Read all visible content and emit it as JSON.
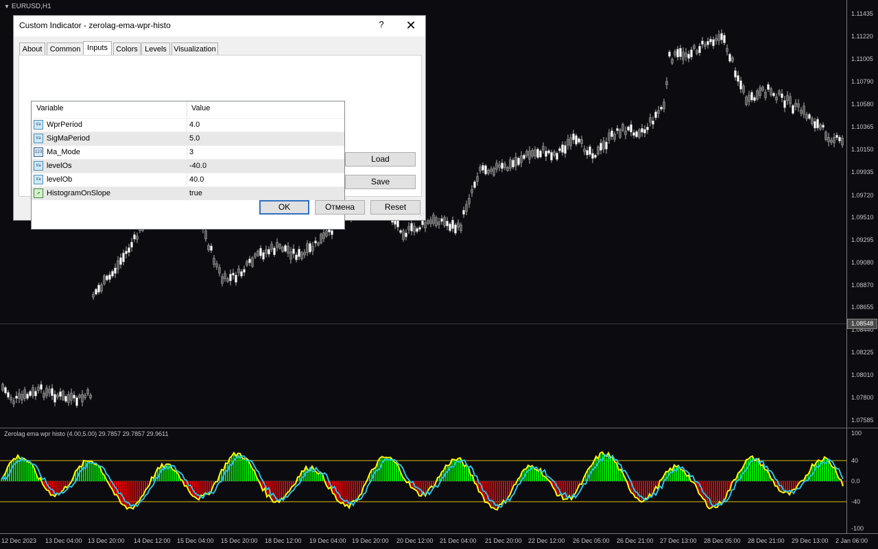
{
  "chart": {
    "symbol": "EURUSD,H1",
    "current_price": "1.08548",
    "price_ticks": [
      "1.11435",
      "1.11220",
      "1.11005",
      "1.10790",
      "1.10580",
      "1.10365",
      "1.10150",
      "1.09935",
      "1.09720",
      "1.09510",
      "1.09295",
      "1.09080",
      "1.08870",
      "1.08655",
      "1.08440",
      "1.08225",
      "1.08010",
      "1.07800",
      "1.07585"
    ],
    "time_ticks": [
      "12 Dec 2023",
      "13 Dec 04:00",
      "13 Dec 20:00",
      "14 Dec 12:00",
      "15 Dec 04:00",
      "15 Dec 20:00",
      "18 Dec 12:00",
      "19 Dec 04:00",
      "19 Dec 20:00",
      "20 Dec 12:00",
      "21 Dec 04:00",
      "21 Dec 20:00",
      "22 Dec 12:00",
      "26 Dec 05:00",
      "26 Dec 21:00",
      "27 Dec 13:00",
      "28 Dec 05:00",
      "28 Dec 21:00",
      "29 Dec 13:00",
      "2 Jan 06:00"
    ],
    "colors": {
      "background": "#0b0b10",
      "candle": "#b4b4b4",
      "histo_up": "#00e000",
      "histo_down": "#e00000",
      "wpr_line": "#ffff00",
      "signal_line": "#2ec4e6",
      "level_line": "#e6c200"
    }
  },
  "indicator": {
    "title": "Zerolag ema wpr histo (4.00,5.00) 29.7857 29.7857 29.9611",
    "ticks": [
      "100",
      "40",
      "0.0",
      "-40",
      "-100"
    ]
  },
  "dialog": {
    "title": "Custom Indicator - zerolag-ema-wpr-histo",
    "help": "?",
    "close": "✕",
    "tabs": [
      "About",
      "Common",
      "Inputs",
      "Colors",
      "Levels",
      "Visualization"
    ],
    "active_tab": "Inputs",
    "columns": [
      "Variable",
      "Value"
    ],
    "rows": [
      {
        "icon": "double-type-icon",
        "variable": "WprPeriod",
        "value": "4.0"
      },
      {
        "icon": "double-type-icon",
        "variable": "SigMaPeriod",
        "value": "5.0"
      },
      {
        "icon": "integer-type-icon",
        "variable": "Ma_Mode",
        "value": "3"
      },
      {
        "icon": "double-type-icon",
        "variable": "levelOs",
        "value": "-40.0"
      },
      {
        "icon": "double-type-icon",
        "variable": "levelOb",
        "value": "40.0"
      },
      {
        "icon": "bool-type-icon",
        "variable": "HistogramOnSlope",
        "value": "true"
      }
    ],
    "load_label": "Load",
    "save_label": "Save",
    "ok_label": "OK",
    "cancel_label": "Отмена",
    "reset_label": "Reset"
  }
}
